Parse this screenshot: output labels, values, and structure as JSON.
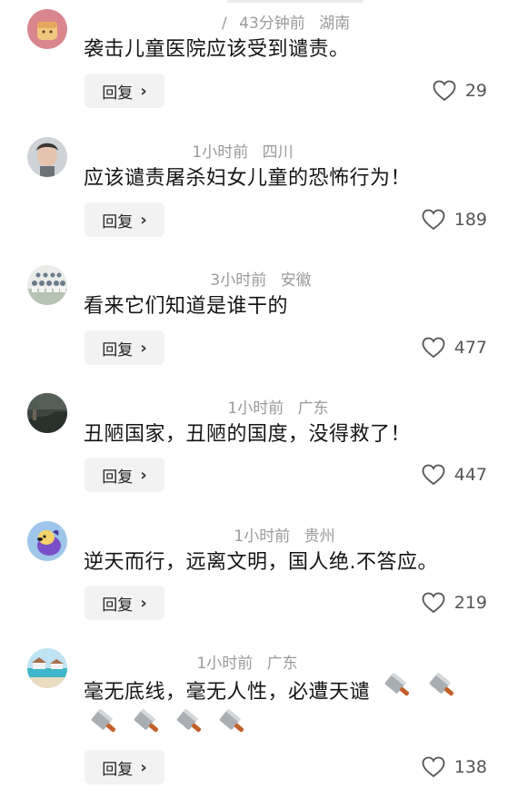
{
  "reply_label": "回复",
  "reply_chevron": "›",
  "comments": [
    {
      "user": "/",
      "time": "43分钟前",
      "location": "湖南",
      "text": "袭击儿童医院应该受到谴责。",
      "likes": "29",
      "avatar": "bread-avatar"
    },
    {
      "user": "",
      "time": "1小时前",
      "location": "四川",
      "text": "应该谴责屠杀妇女儿童的恐怖行为！",
      "likes": "189",
      "avatar": "person-avatar"
    },
    {
      "user": "",
      "time": "3小时前",
      "location": "安徽",
      "text": "看来它们知道是谁干的",
      "likes": "477",
      "avatar": "group-photo-avatar"
    },
    {
      "user": "",
      "time": "1小时前",
      "location": "广东",
      "text": "丑陋国家，丑陋的国度，没得救了！",
      "likes": "447",
      "avatar": "dark-landscape-avatar"
    },
    {
      "user": "",
      "time": "1小时前",
      "location": "贵州",
      "text": "逆天而行，远离文明，国人绝.不答应。",
      "likes": "219",
      "avatar": "cartoon-dog-avatar"
    },
    {
      "user": "",
      "time": "1小时前",
      "location": "广东",
      "text": "毫无底线，毫无人性，必遭天谴",
      "knife_emoji_count": 6,
      "likes": "138",
      "avatar": "beach-avatar"
    }
  ],
  "colors": {
    "meta_text": "#9a9a9a",
    "reply_bg": "#f2f2f2",
    "body_text": "#151515"
  },
  "icons": [
    "heart-outline-icon",
    "kitchen-knife-icon",
    "chevron-right-icon"
  ]
}
